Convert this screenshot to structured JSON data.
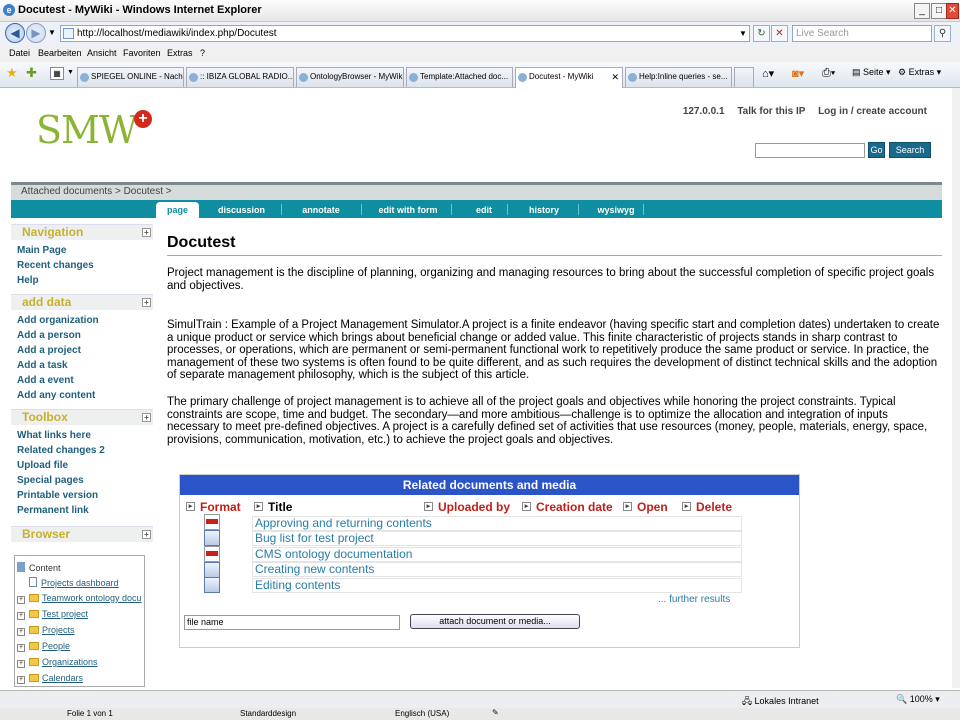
{
  "window": {
    "title": "Docutest - MyWiki - Windows Internet Explorer"
  },
  "browser": {
    "address": "http://localhost/mediawiki/index.php/Docutest",
    "live_search_placeholder": "Live Search",
    "menu": [
      "Datei",
      "Bearbeiten",
      "Ansicht",
      "Favoriten",
      "Extras",
      "?"
    ],
    "tabs": [
      "SPIEGEL ONLINE - Nach...",
      ":: IBIZA GLOBAL RADIO...",
      "OntologyBrowser - MyWiki",
      "Template:Attached doc...",
      "Docutest - MyWiki",
      "Help:Inline queries - se..."
    ],
    "tools": {
      "page": "Seite",
      "extras": "Extras"
    }
  },
  "site": {
    "logo": "SMW",
    "logo_plus": "+",
    "userlinks": [
      "127.0.0.1",
      "Talk for this IP",
      "Log in / create account"
    ],
    "go_label": "Go",
    "search_label": "Search",
    "breadcrumb": "Attached documents >   Docutest >"
  },
  "page_tabs": [
    "page",
    "discussion",
    "annotate",
    "edit with form",
    "edit",
    "history",
    "wysiwyg"
  ],
  "sidebar": {
    "navigation": {
      "title": "Navigation",
      "items": [
        "Main Page",
        "Recent changes",
        "Help"
      ]
    },
    "add_data": {
      "title": "add data",
      "items": [
        "Add organization",
        "Add a person",
        "Add a project",
        "Add a task",
        "Add a event",
        "Add any content"
      ]
    },
    "toolbox": {
      "title": "Toolbox",
      "items": [
        "What links here",
        "Related changes 2",
        "Upload file",
        "Special pages",
        "Printable version",
        "Permanent link"
      ]
    },
    "browser": {
      "title": "Browser",
      "tree": [
        "Content",
        "Projects dashboard",
        "Teamwork ontology docu",
        "Test project",
        "Projects",
        "People",
        "Organizations",
        "Calendars"
      ]
    }
  },
  "content": {
    "title": "Docutest",
    "p1": "Project management is the discipline of planning, organizing and managing resources to bring about the successful completion of specific project goals and objectives.",
    "p2": "SimulTrain : Example of a Project Management Simulator.A project is a finite endeavor (having specific start and completion dates) undertaken to create a unique product or service which brings about beneficial change or added value. This finite characteristic of projects stands in sharp contrast to processes, or operations, which are permanent or semi-permanent functional work to repetitively produce the same product or service. In practice, the management of these two systems is often found to be quite different, and as such requires the development of distinct technical skills and the adoption of separate management philosophy, which is the subject of this article.",
    "p3": "The primary challenge of project management is to achieve all of the project goals and objectives while honoring the project constraints. Typical constraints are scope, time and budget. The secondary—and more ambitious—challenge is to optimize the allocation and integration of inputs necessary to meet pre-defined objectives. A project is a carefully defined set of activities that use resources (money, people, materials, energy, space, provisions, communication, motivation, etc.) to achieve the project goals and objectives."
  },
  "documents": {
    "header": "Related documents and media",
    "columns": [
      "Format",
      "Title",
      "Uploaded by",
      "Creation date",
      "Open",
      "Delete"
    ],
    "rows": [
      {
        "format": "pdf",
        "title": "Approving and returning contents"
      },
      {
        "format": "doc",
        "title": "Bug list for test project"
      },
      {
        "format": "pdf",
        "title": "CMS ontology documentation"
      },
      {
        "format": "doc",
        "title": "Creating new contents"
      },
      {
        "format": "doc",
        "title": "Editing contents"
      }
    ],
    "further": "... further results",
    "file_placeholder": "file name",
    "attach_label": "attach document or media..."
  },
  "status": {
    "zone": "Lokales Intranet",
    "zoom": "100%"
  },
  "taskbar": {
    "page": "Folie 1 von 1",
    "design": "Standarddesign",
    "language": "Englisch (USA)"
  }
}
